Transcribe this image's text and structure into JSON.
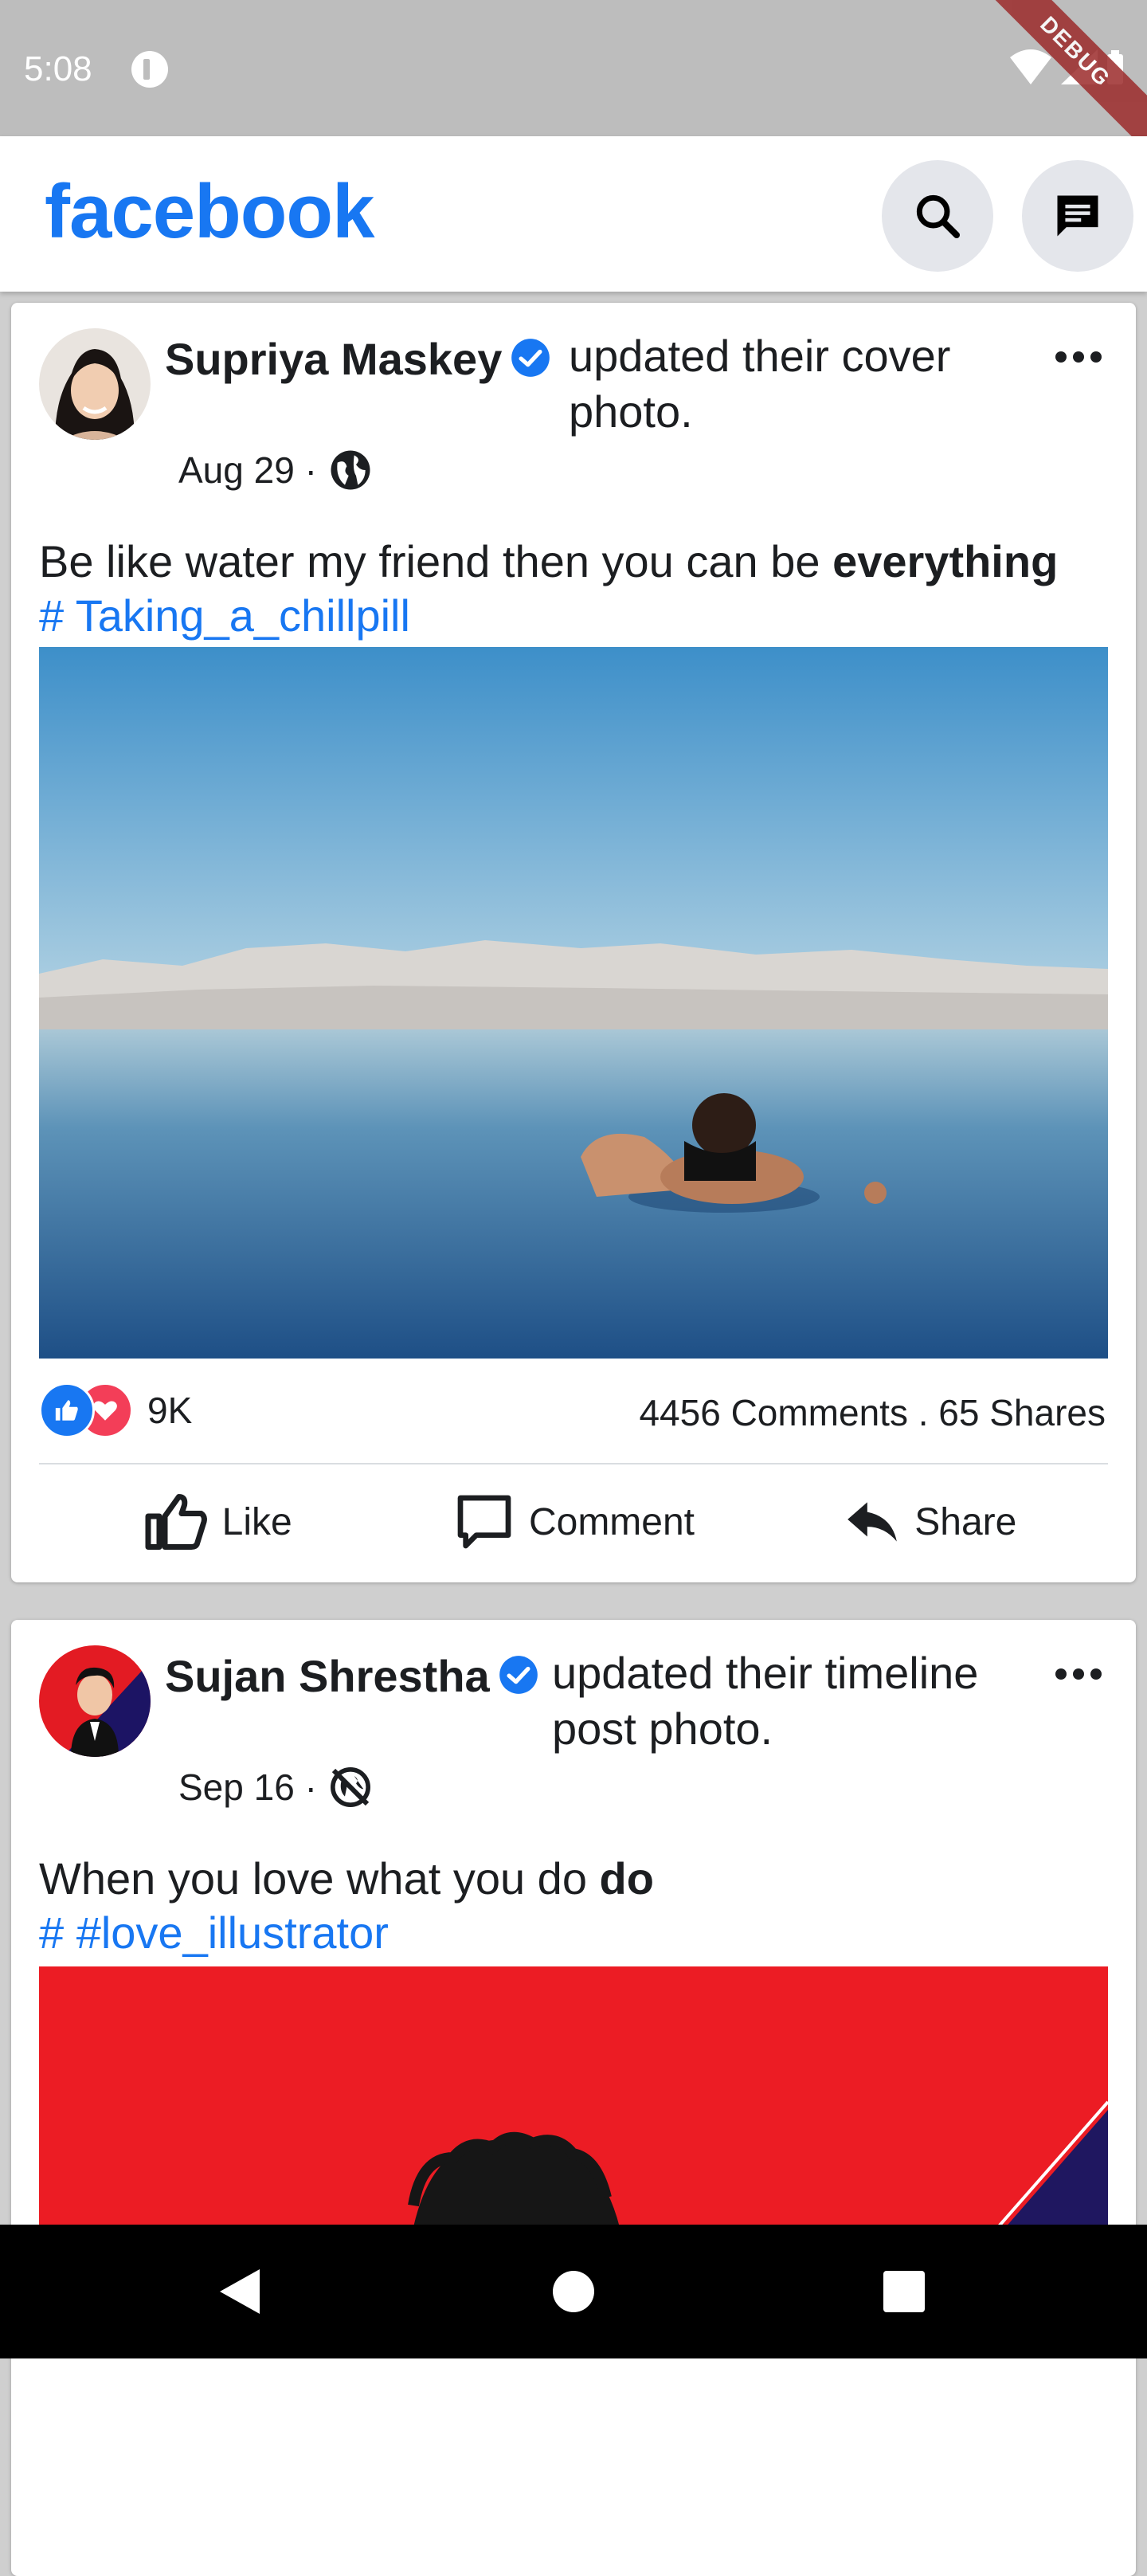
{
  "status_bar": {
    "time": "5:08",
    "debug_label": "DEBUG"
  },
  "app_bar": {
    "brand": "facebook"
  },
  "posts": [
    {
      "author": "Supriya Maskey",
      "action": "updated their cover photo.",
      "date": "Aug 29 ·",
      "visibility_icon": "globe-icon",
      "text": "Be like water my friend then you can be ",
      "text_bold": "everything",
      "hashtag": "# Taking_a_chillpill",
      "reactions_count": "9K",
      "stats": "4456 Comments . 65 Shares"
    },
    {
      "author": "Sujan Shrestha",
      "action": "updated their timeline post photo.",
      "date": "Sep 16 ·",
      "visibility_icon": "private-globe-icon",
      "text": "When you love what you do ",
      "text_bold": "do",
      "hashtag": "# #love_illustrator"
    }
  ],
  "actions": {
    "like": "Like",
    "comment": "Comment",
    "share": "Share"
  },
  "colors": {
    "brand": "#1877f2",
    "like": "#1877f2",
    "love": "#f33e58"
  }
}
